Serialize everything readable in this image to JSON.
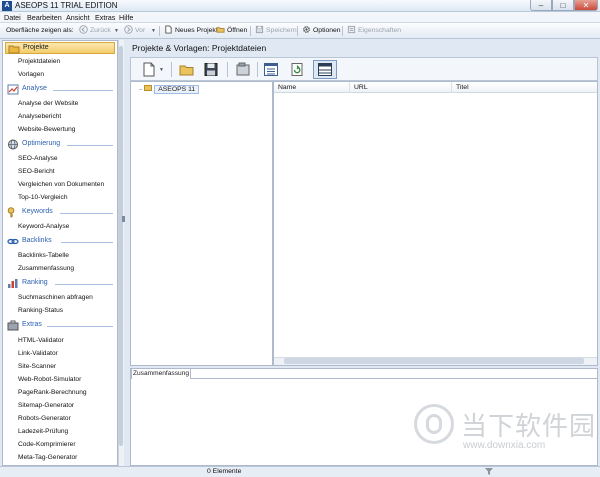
{
  "window": {
    "title": "ASEOPS 11 TRIAL EDITION",
    "icon_letter": "A"
  },
  "menu": [
    "Datei",
    "Bearbeiten",
    "Ansicht",
    "Extras",
    "Hilfe"
  ],
  "toolbar": {
    "view_label": "Oberfläche zeigen als:",
    "back": "Zurück",
    "forward": "Vor",
    "new_project": "Neues Projekt",
    "open": "Öffnen",
    "save": "Speichern",
    "options": "Optionen",
    "properties": "Eigenschaften"
  },
  "sidebar": {
    "sections": [
      {
        "label": "Projekte",
        "items": [
          "Projektdateien",
          "Vorlagen"
        ]
      },
      {
        "label": "Analyse",
        "items": [
          "Analyse der Website",
          "Analysebericht",
          "Website-Bewertung"
        ]
      },
      {
        "label": "Optimierung",
        "items": [
          "SEO-Analyse",
          "SEO-Bericht",
          "Vergleichen von Dokumenten",
          "Top-10-Vergleich"
        ]
      },
      {
        "label": "Keywords",
        "items": [
          "Keyword-Analyse"
        ]
      },
      {
        "label": "Backlinks",
        "items": [
          "Backlinks-Tabelle",
          "Zusammenfassung"
        ]
      },
      {
        "label": "Ranking",
        "items": [
          "Suchmaschinen abfragen",
          "Ranking-Status"
        ]
      },
      {
        "label": "Extras",
        "items": [
          "HTML-Validator",
          "Link-Validator",
          "Site-Scanner",
          "Web-Robot-Simulator",
          "PageRank-Berechnung",
          "Sitemap-Generator",
          "Robots-Generator",
          "Ladezeit-Prüfung",
          "Code-Komprimierer",
          "Meta-Tag-Generator"
        ]
      }
    ]
  },
  "main": {
    "title": "Projekte & Vorlagen: Projektdateien",
    "tree_root": "ASEOPS 11",
    "columns": [
      "Name",
      "URL",
      "Titel"
    ],
    "bottom_tab": "Zusammenfassung"
  },
  "status": {
    "count": "0 Elemente"
  },
  "watermark": {
    "cn": "当下软件园",
    "url": "www.downxia.com"
  }
}
